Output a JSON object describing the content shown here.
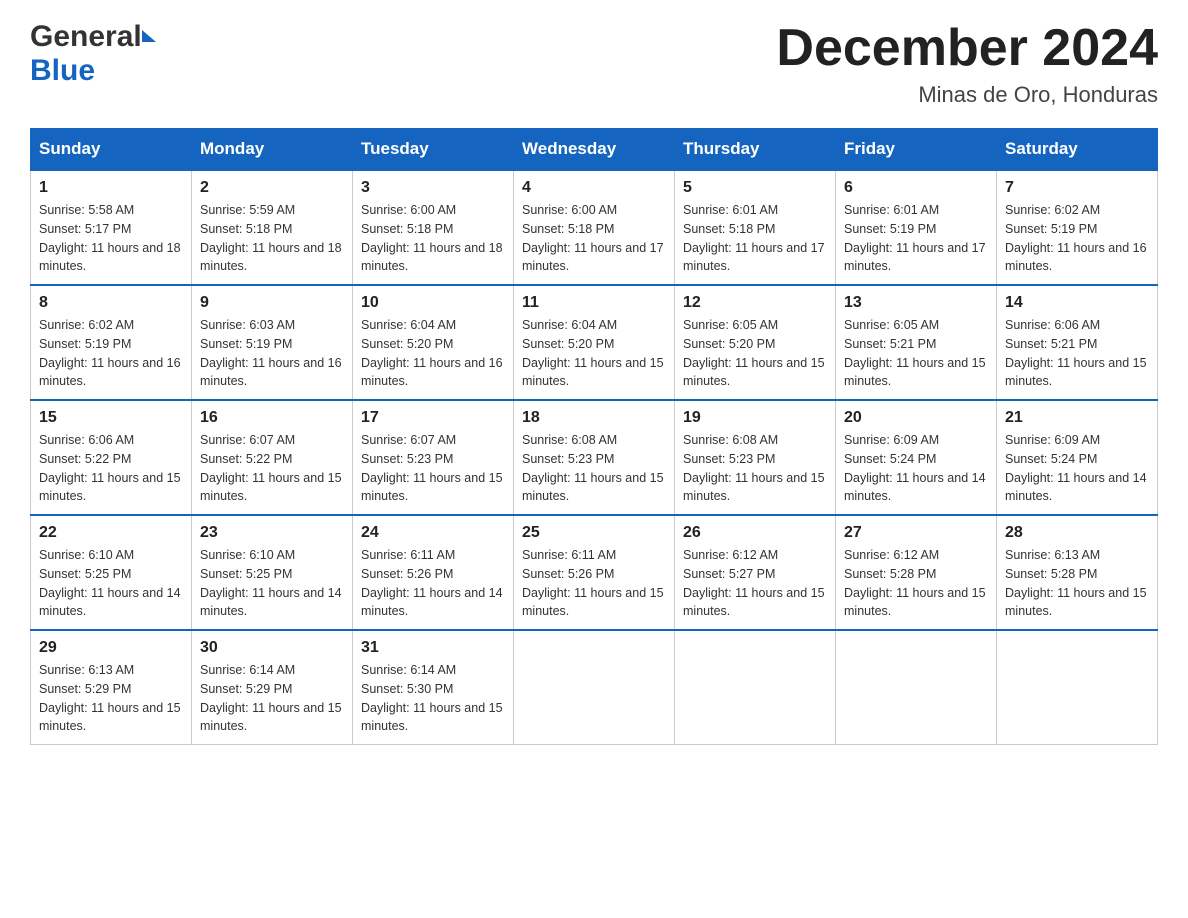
{
  "header": {
    "logo_general": "General",
    "logo_blue": "Blue",
    "title": "December 2024",
    "subtitle": "Minas de Oro, Honduras"
  },
  "weekdays": [
    "Sunday",
    "Monday",
    "Tuesday",
    "Wednesday",
    "Thursday",
    "Friday",
    "Saturday"
  ],
  "weeks": [
    [
      {
        "day": "1",
        "sunrise": "5:58 AM",
        "sunset": "5:17 PM",
        "daylight": "11 hours and 18 minutes."
      },
      {
        "day": "2",
        "sunrise": "5:59 AM",
        "sunset": "5:18 PM",
        "daylight": "11 hours and 18 minutes."
      },
      {
        "day": "3",
        "sunrise": "6:00 AM",
        "sunset": "5:18 PM",
        "daylight": "11 hours and 18 minutes."
      },
      {
        "day": "4",
        "sunrise": "6:00 AM",
        "sunset": "5:18 PM",
        "daylight": "11 hours and 17 minutes."
      },
      {
        "day": "5",
        "sunrise": "6:01 AM",
        "sunset": "5:18 PM",
        "daylight": "11 hours and 17 minutes."
      },
      {
        "day": "6",
        "sunrise": "6:01 AM",
        "sunset": "5:19 PM",
        "daylight": "11 hours and 17 minutes."
      },
      {
        "day": "7",
        "sunrise": "6:02 AM",
        "sunset": "5:19 PM",
        "daylight": "11 hours and 16 minutes."
      }
    ],
    [
      {
        "day": "8",
        "sunrise": "6:02 AM",
        "sunset": "5:19 PM",
        "daylight": "11 hours and 16 minutes."
      },
      {
        "day": "9",
        "sunrise": "6:03 AM",
        "sunset": "5:19 PM",
        "daylight": "11 hours and 16 minutes."
      },
      {
        "day": "10",
        "sunrise": "6:04 AM",
        "sunset": "5:20 PM",
        "daylight": "11 hours and 16 minutes."
      },
      {
        "day": "11",
        "sunrise": "6:04 AM",
        "sunset": "5:20 PM",
        "daylight": "11 hours and 15 minutes."
      },
      {
        "day": "12",
        "sunrise": "6:05 AM",
        "sunset": "5:20 PM",
        "daylight": "11 hours and 15 minutes."
      },
      {
        "day": "13",
        "sunrise": "6:05 AM",
        "sunset": "5:21 PM",
        "daylight": "11 hours and 15 minutes."
      },
      {
        "day": "14",
        "sunrise": "6:06 AM",
        "sunset": "5:21 PM",
        "daylight": "11 hours and 15 minutes."
      }
    ],
    [
      {
        "day": "15",
        "sunrise": "6:06 AM",
        "sunset": "5:22 PM",
        "daylight": "11 hours and 15 minutes."
      },
      {
        "day": "16",
        "sunrise": "6:07 AM",
        "sunset": "5:22 PM",
        "daylight": "11 hours and 15 minutes."
      },
      {
        "day": "17",
        "sunrise": "6:07 AM",
        "sunset": "5:23 PM",
        "daylight": "11 hours and 15 minutes."
      },
      {
        "day": "18",
        "sunrise": "6:08 AM",
        "sunset": "5:23 PM",
        "daylight": "11 hours and 15 minutes."
      },
      {
        "day": "19",
        "sunrise": "6:08 AM",
        "sunset": "5:23 PM",
        "daylight": "11 hours and 15 minutes."
      },
      {
        "day": "20",
        "sunrise": "6:09 AM",
        "sunset": "5:24 PM",
        "daylight": "11 hours and 14 minutes."
      },
      {
        "day": "21",
        "sunrise": "6:09 AM",
        "sunset": "5:24 PM",
        "daylight": "11 hours and 14 minutes."
      }
    ],
    [
      {
        "day": "22",
        "sunrise": "6:10 AM",
        "sunset": "5:25 PM",
        "daylight": "11 hours and 14 minutes."
      },
      {
        "day": "23",
        "sunrise": "6:10 AM",
        "sunset": "5:25 PM",
        "daylight": "11 hours and 14 minutes."
      },
      {
        "day": "24",
        "sunrise": "6:11 AM",
        "sunset": "5:26 PM",
        "daylight": "11 hours and 14 minutes."
      },
      {
        "day": "25",
        "sunrise": "6:11 AM",
        "sunset": "5:26 PM",
        "daylight": "11 hours and 15 minutes."
      },
      {
        "day": "26",
        "sunrise": "6:12 AM",
        "sunset": "5:27 PM",
        "daylight": "11 hours and 15 minutes."
      },
      {
        "day": "27",
        "sunrise": "6:12 AM",
        "sunset": "5:28 PM",
        "daylight": "11 hours and 15 minutes."
      },
      {
        "day": "28",
        "sunrise": "6:13 AM",
        "sunset": "5:28 PM",
        "daylight": "11 hours and 15 minutes."
      }
    ],
    [
      {
        "day": "29",
        "sunrise": "6:13 AM",
        "sunset": "5:29 PM",
        "daylight": "11 hours and 15 minutes."
      },
      {
        "day": "30",
        "sunrise": "6:14 AM",
        "sunset": "5:29 PM",
        "daylight": "11 hours and 15 minutes."
      },
      {
        "day": "31",
        "sunrise": "6:14 AM",
        "sunset": "5:30 PM",
        "daylight": "11 hours and 15 minutes."
      },
      null,
      null,
      null,
      null
    ]
  ]
}
